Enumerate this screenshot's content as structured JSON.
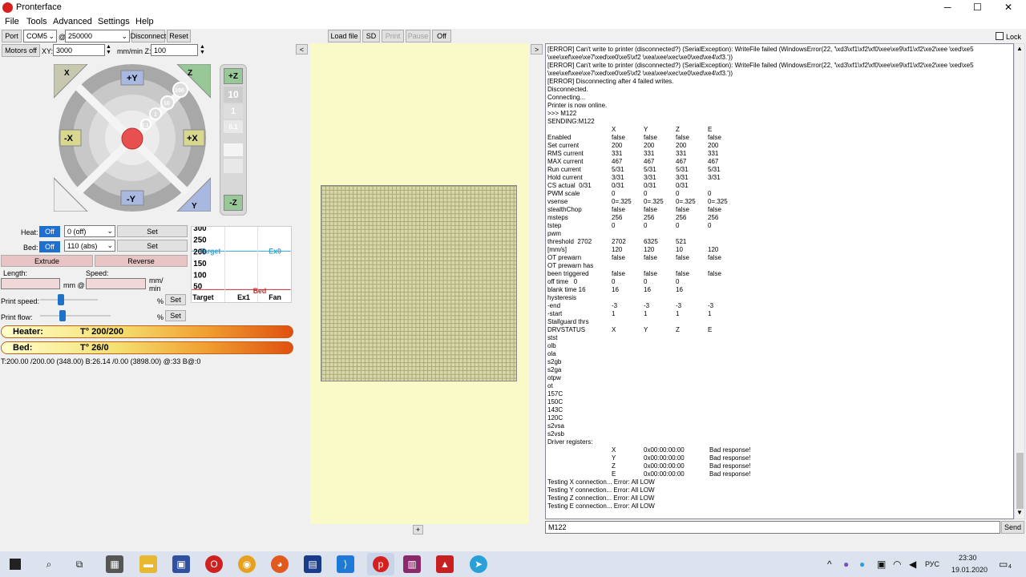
{
  "window": {
    "title": "Pronterface",
    "minimize": "─",
    "maximize": "☐",
    "close": "✕"
  },
  "menu": [
    "File",
    "Tools",
    "Advanced",
    "Settings",
    "Help"
  ],
  "toolbar": {
    "port_label": "Port",
    "port_value": "COM5",
    "at": "@",
    "baud_value": "250000",
    "disconnect": "Disconnect",
    "reset": "Reset",
    "motors_off": "Motors off",
    "xy_label": "XY:",
    "xy_value": "3000",
    "mm_min": "mm/min Z:",
    "z_value": "100",
    "load_file": "Load file",
    "sd": "SD",
    "print": "Print",
    "pause": "Pause",
    "off": "Off",
    "lock": "Lock",
    "collapse_left": "<",
    "collapse_right": ">"
  },
  "jog": {
    "home_x": "X",
    "plus_y": "+Y",
    "home_z": "Z",
    "minus_x": "-X",
    "plus_x": "+X",
    "minus_y": "-Y",
    "home_y": "Y",
    "steps": [
      "100",
      "10",
      "1",
      "0.1"
    ],
    "plus_z": "+Z",
    "minus_z": "-Z",
    "z_steps": [
      "10",
      "1",
      "0.1"
    ]
  },
  "temp": {
    "heat_label": "Heat:",
    "heat_off": "Off",
    "heat_value": "0 (off)",
    "set": "Set",
    "bed_label": "Bed:",
    "bed_off": "Off",
    "bed_value": "110 (abs)",
    "extrude": "Extrude",
    "reverse": "Reverse",
    "length_label": "Length:",
    "mm_at": "mm @",
    "speed_label": "Speed:",
    "mm_min2": "mm/\nmin",
    "print_speed": "Print speed:",
    "print_flow": "Print flow:",
    "pct": "%",
    "heater_bar": "Heater:",
    "heater_val": "T° 200/200",
    "bed_bar": "Bed:",
    "bed_val": "T° 26/0",
    "status_line": "T:200.00 /200.00 (348.00) B:26.14 /0.00 (3898.00) @:33 B@:0"
  },
  "graph": {
    "y_ticks": [
      "300",
      "250",
      "200",
      "150",
      "100",
      "50"
    ],
    "target_label": "Target",
    "ex0": "Ex0",
    "bed": "Bed",
    "legend": [
      "Target",
      "Ex1",
      "Fan"
    ]
  },
  "console_lines": [
    "[ERROR] Can't write to printer (disconnected?) (SerialException): WriteFile failed (WindowsError(22, '\\xd3\\xf1\\xf2\\xf0\\xee\\xe9\\xf1\\xf2\\xe2\\xee \\xed\\xe5",
    "\\xee\\xef\\xee\\xe7\\xed\\xe0\\xe5\\xf2 \\xea\\xee\\xec\\xe0\\xed\\xe4\\xf3.'))",
    "[ERROR] Can't write to printer (disconnected?) (SerialException): WriteFile failed (WindowsError(22, '\\xd3\\xf1\\xf2\\xf0\\xee\\xe9\\xf1\\xf2\\xe2\\xee \\xed\\xe5",
    "\\xee\\xef\\xee\\xe7\\xed\\xe0\\xe5\\xf2 \\xea\\xee\\xec\\xe0\\xed\\xe4\\xf3.'))",
    "[ERROR] Disconnecting after 4 failed writes.",
    "Disconnected.",
    "Connecting...",
    "Printer is now online.",
    ">>> M122",
    "SENDING:M122"
  ],
  "console_table": [
    [
      "",
      "X",
      "Y",
      "Z",
      "E"
    ],
    [
      "Enabled",
      "false",
      "false",
      "false",
      "false"
    ],
    [
      "Set current",
      "200",
      "200",
      "200",
      "200"
    ],
    [
      "RMS current",
      "331",
      "331",
      "331",
      "331"
    ],
    [
      "MAX current",
      "467",
      "467",
      "467",
      "467"
    ],
    [
      "Run current",
      "5/31",
      "5/31",
      "5/31",
      "5/31"
    ],
    [
      "Hold current",
      "3/31",
      "3/31",
      "3/31",
      "3/31"
    ],
    [
      "CS actual  0/31",
      "0/31",
      "0/31",
      "0/31",
      ""
    ],
    [
      "PWM scale",
      "0",
      "0",
      "0",
      "0"
    ],
    [
      "vsense",
      "0=.325",
      "0=.325",
      "0=.325",
      "0=.325"
    ],
    [
      "stealthChop",
      "false",
      "false",
      "false",
      "false"
    ],
    [
      "msteps",
      "256",
      "256",
      "256",
      "256"
    ],
    [
      "tstep",
      "0",
      "0",
      "0",
      "0"
    ],
    [
      "pwm",
      "",
      "",
      "",
      ""
    ],
    [
      "threshold  2702",
      "2702",
      "6325",
      "521",
      ""
    ],
    [
      "[mm/s]",
      "120",
      "120",
      "10",
      "120"
    ],
    [
      "OT prewarn",
      "false",
      "false",
      "false",
      "false"
    ],
    [
      "OT prewarn has",
      "",
      "",
      "",
      ""
    ],
    [
      "been triggered",
      "false",
      "false",
      "false",
      "false"
    ],
    [
      "off time   0",
      "0",
      "0",
      "0",
      ""
    ],
    [
      "blank time 16",
      "16",
      "16",
      "16",
      ""
    ],
    [
      "hysteresis",
      "",
      "",
      "",
      ""
    ],
    [
      "-end",
      "-3",
      "-3",
      "-3",
      "-3"
    ],
    [
      "-start",
      "1",
      "1",
      "1",
      "1"
    ],
    [
      "Stallguard thrs",
      "",
      "",
      "",
      ""
    ],
    [
      "DRVSTATUS",
      "X",
      "Y",
      "Z",
      "E"
    ]
  ],
  "console_tail": [
    "stst",
    "olb",
    "ola",
    "s2gb",
    "s2ga",
    "otpw",
    "ot",
    "157C",
    "150C",
    "143C",
    "120C",
    "s2vsa",
    "s2vsb",
    "Driver registers:"
  ],
  "console_regs": [
    [
      "X",
      "0x00:00:00:00",
      "Bad response!"
    ],
    [
      "Y",
      "0x00:00:00:00",
      "Bad response!"
    ],
    [
      "Z",
      "0x00:00:00:00",
      "Bad response!"
    ],
    [
      "E",
      "0x00:00:00:00",
      "Bad response!"
    ]
  ],
  "console_end": [
    "Testing X connection... Error: All LOW",
    "Testing Y connection... Error: All LOW",
    "Testing Z connection... Error: All LOW",
    "Testing E connection... Error: All LOW"
  ],
  "command": {
    "value": "M122",
    "send": "Send"
  },
  "viewer": {
    "plus": "+"
  },
  "taskbar": {
    "lang": "РУС",
    "time": "23:30",
    "date": "19.01.2020",
    "notif": "4"
  }
}
